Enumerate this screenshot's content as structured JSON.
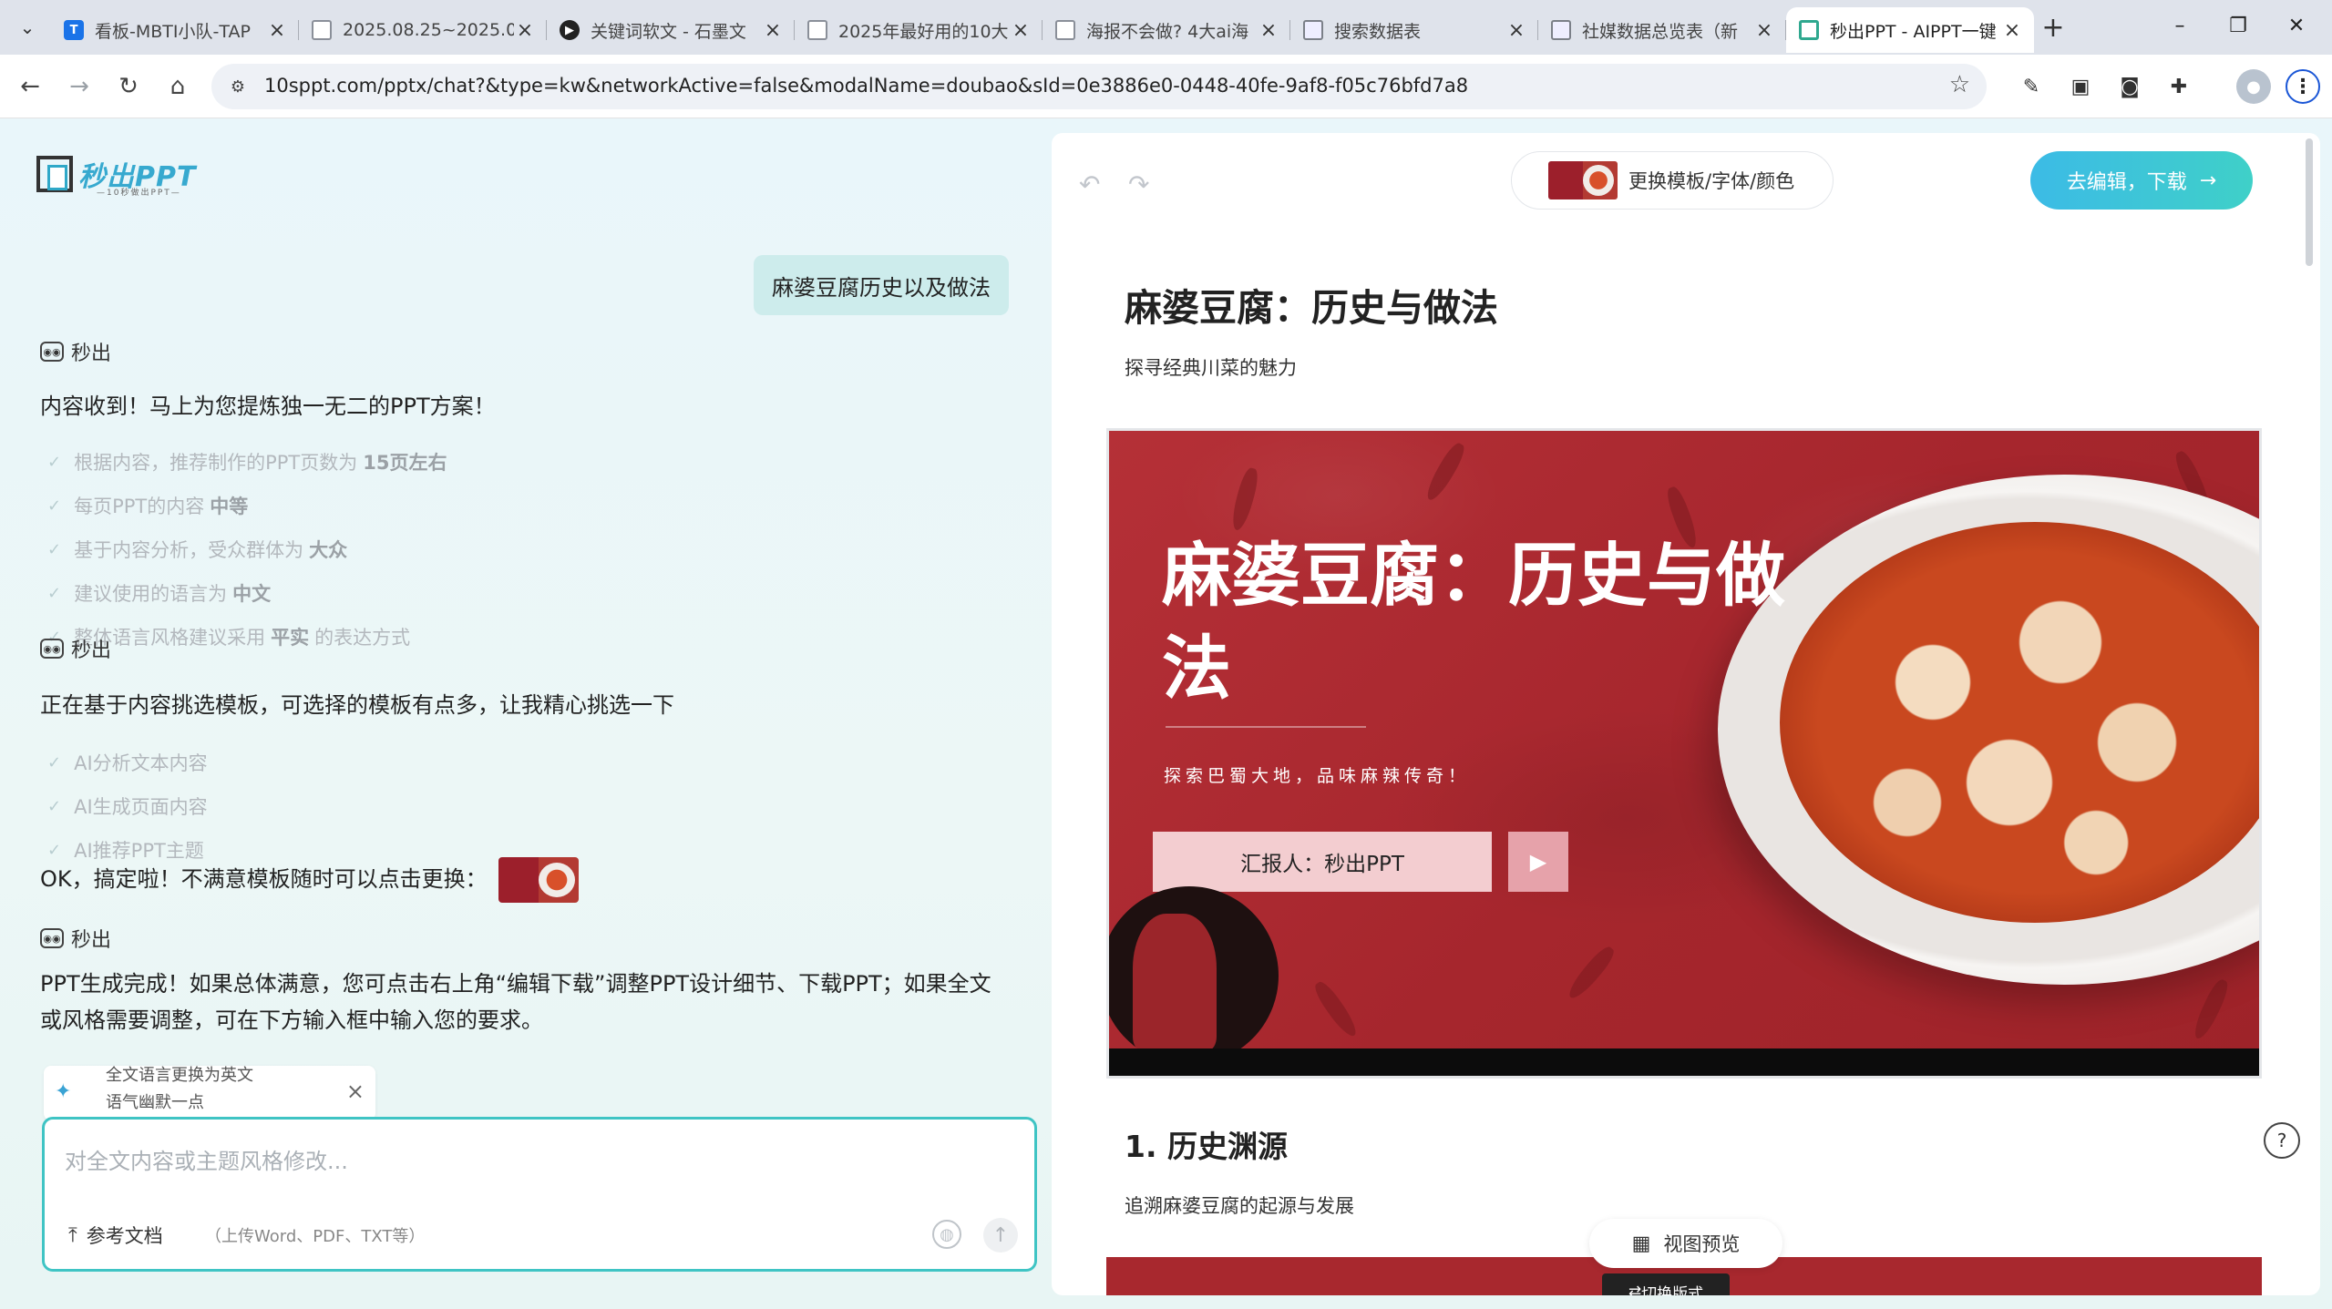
{
  "browser": {
    "tabs": [
      {
        "title": "看板-MBTI小队-TAP",
        "favicon": "blue"
      },
      {
        "title": "2025.08.25~2025.0",
        "favicon": "doc"
      },
      {
        "title": "关键词软文 - 石墨文",
        "favicon": "dark"
      },
      {
        "title": "2025年最好用的10大",
        "favicon": "doc"
      },
      {
        "title": "海报不会做? 4大ai海",
        "favicon": "doc"
      },
      {
        "title": "搜索数据表",
        "favicon": "sheet"
      },
      {
        "title": "社媒数据总览表（新",
        "favicon": "sheet"
      },
      {
        "title": "秒出PPT - AIPPT一键",
        "favicon": "ppt",
        "active": true
      }
    ],
    "url": "10sppt.com/pptx/chat?&type=kw&networkActive=false&modalName=doubao&sId=0e3886e0-0448-40fe-9af8-f05c76bfd7a8"
  },
  "app": {
    "logo_text": "秒出PPT",
    "logo_sub": "—10秒做出PPT—",
    "user_message": "麻婆豆腐历史以及做法",
    "bot_name": "秒出",
    "msg1": "内容收到！马上为您提炼独一无二的PPT方案！",
    "checks1": [
      {
        "pre": "根据内容，推荐制作的PPT页数为",
        "bold": "15页左右",
        "post": ""
      },
      {
        "pre": "每页PPT的内容",
        "bold": "中等",
        "post": ""
      },
      {
        "pre": "基于内容分析，受众群体为",
        "bold": "大众",
        "post": ""
      },
      {
        "pre": "建议使用的语言为",
        "bold": "中文",
        "post": ""
      },
      {
        "pre": "整体语言风格建议采用",
        "bold": "平实",
        "post": "的表达方式"
      }
    ],
    "msg2": "正在基于内容挑选模板，可选择的模板有点多，让我精心挑选一下",
    "checks2": [
      "AI分析文本内容",
      "AI生成页面内容",
      "AI推荐PPT主题"
    ],
    "msg3": "OK，搞定啦！不满意模板随时可以点击更换：",
    "msg4": "PPT生成完成！如果总体满意，您可点击右上角“编辑下载”调整PPT设计细节、下载PPT；如果全文或风格需要调整，可在下方输入框中输入您的要求。",
    "suggest_line1": "全文语言更换为英文",
    "suggest_line2": "语气幽默一点",
    "input_placeholder": "对全文内容或主题风格修改...",
    "upload_label": "参考文档",
    "upload_hint": "（上传Word、PDF、TXT等）"
  },
  "preview": {
    "template_button": "更换模板/字体/颜色",
    "edit_button": "去编辑，下载",
    "title": "麻婆豆腐：历史与做法",
    "subtitle": "探寻经典川菜的魅力",
    "slide": {
      "title": "麻婆豆腐：历史与做法",
      "tagline": "探索巴蜀大地，品味麻辣传奇！",
      "reporter": "汇报人：秒出PPT"
    },
    "section_title": "1. 历史渊源",
    "section_subtitle": "追溯麻婆豆腐的起源与发展",
    "view_preview": "视图预览",
    "slide2_caption": "切换版式"
  },
  "colors": {
    "accent_teal": "#3fc4c4",
    "edit_gradient_start": "#3cbbe6",
    "slide_red": "#a8282e"
  }
}
